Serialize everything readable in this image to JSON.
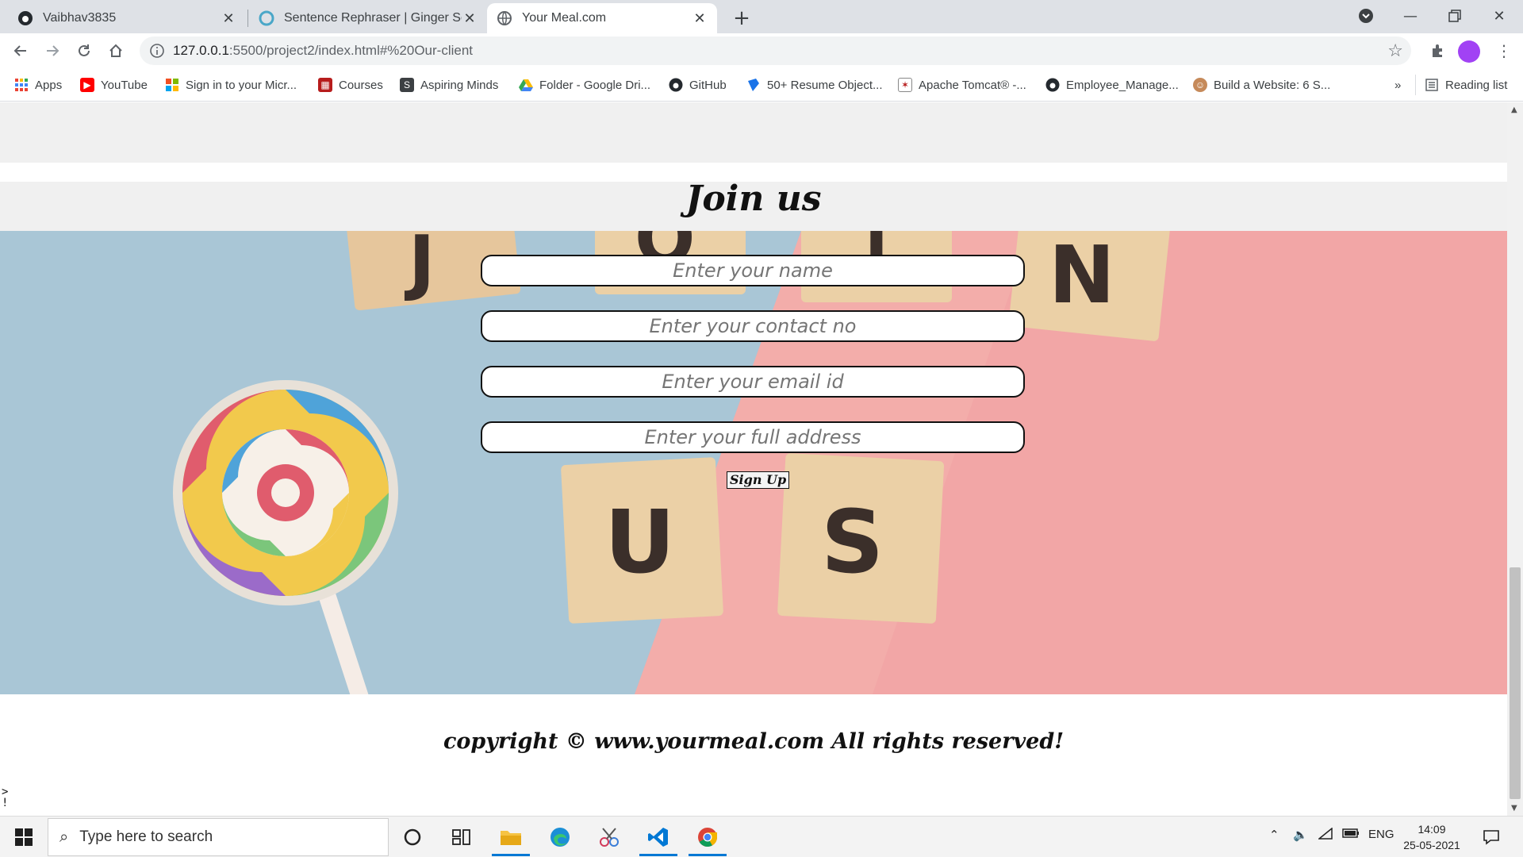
{
  "browser": {
    "tabs": [
      {
        "title": "Vaibhav3835",
        "favicon": "github-icon",
        "active": false
      },
      {
        "title": "Sentence Rephraser | Ginger Soft",
        "favicon": "ginger-icon",
        "active": false
      },
      {
        "title": "Your Meal.com",
        "favicon": "globe-icon",
        "active": true
      }
    ],
    "url_host": "127.0.0.1",
    "url_path": ":5500/project2/index.html#%20Our-client",
    "bookmarks": [
      {
        "label": "Apps",
        "icon": "apps-grid-icon"
      },
      {
        "label": "YouTube",
        "icon": "youtube-icon"
      },
      {
        "label": "Sign in to your Micr...",
        "icon": "microsoft-icon"
      },
      {
        "label": "Courses",
        "icon": "courses-icon"
      },
      {
        "label": "Aspiring Minds",
        "icon": "aspiring-minds-icon"
      },
      {
        "label": "Folder - Google Dri...",
        "icon": "google-drive-icon"
      },
      {
        "label": "GitHub",
        "icon": "github-icon"
      },
      {
        "label": "50+ Resume Object...",
        "icon": "resume-icon"
      },
      {
        "label": "Apache Tomcat® -...",
        "icon": "tomcat-icon"
      },
      {
        "label": "Employee_Manage...",
        "icon": "github-icon"
      },
      {
        "label": "Build a Website: 6 S...",
        "icon": "build-icon"
      }
    ],
    "more_bookmarks": "»",
    "reading_list": "Reading list"
  },
  "page": {
    "join_title": "Join us",
    "form": {
      "name_placeholder": "Enter your name",
      "contact_placeholder": "Enter your contact no",
      "email_placeholder": "Enter your email id",
      "address_placeholder": "Enter your full address",
      "submit_label": "Sign Up"
    },
    "hero_letters": [
      "J",
      "O",
      "I",
      "N",
      "U",
      "S"
    ],
    "copyright": "copyright © www.yourmeal.com All rights reserved!",
    "stray_text": ">\n!"
  },
  "taskbar": {
    "search_placeholder": "Type here to search",
    "language": "ENG",
    "time": "14:09",
    "date": "25-05-2021"
  },
  "colors": {
    "hero_blue": "#a9c6d6",
    "hero_pink": "#f2a6a6",
    "tile": "#e8c9a0",
    "avatar": "#a142f4"
  }
}
